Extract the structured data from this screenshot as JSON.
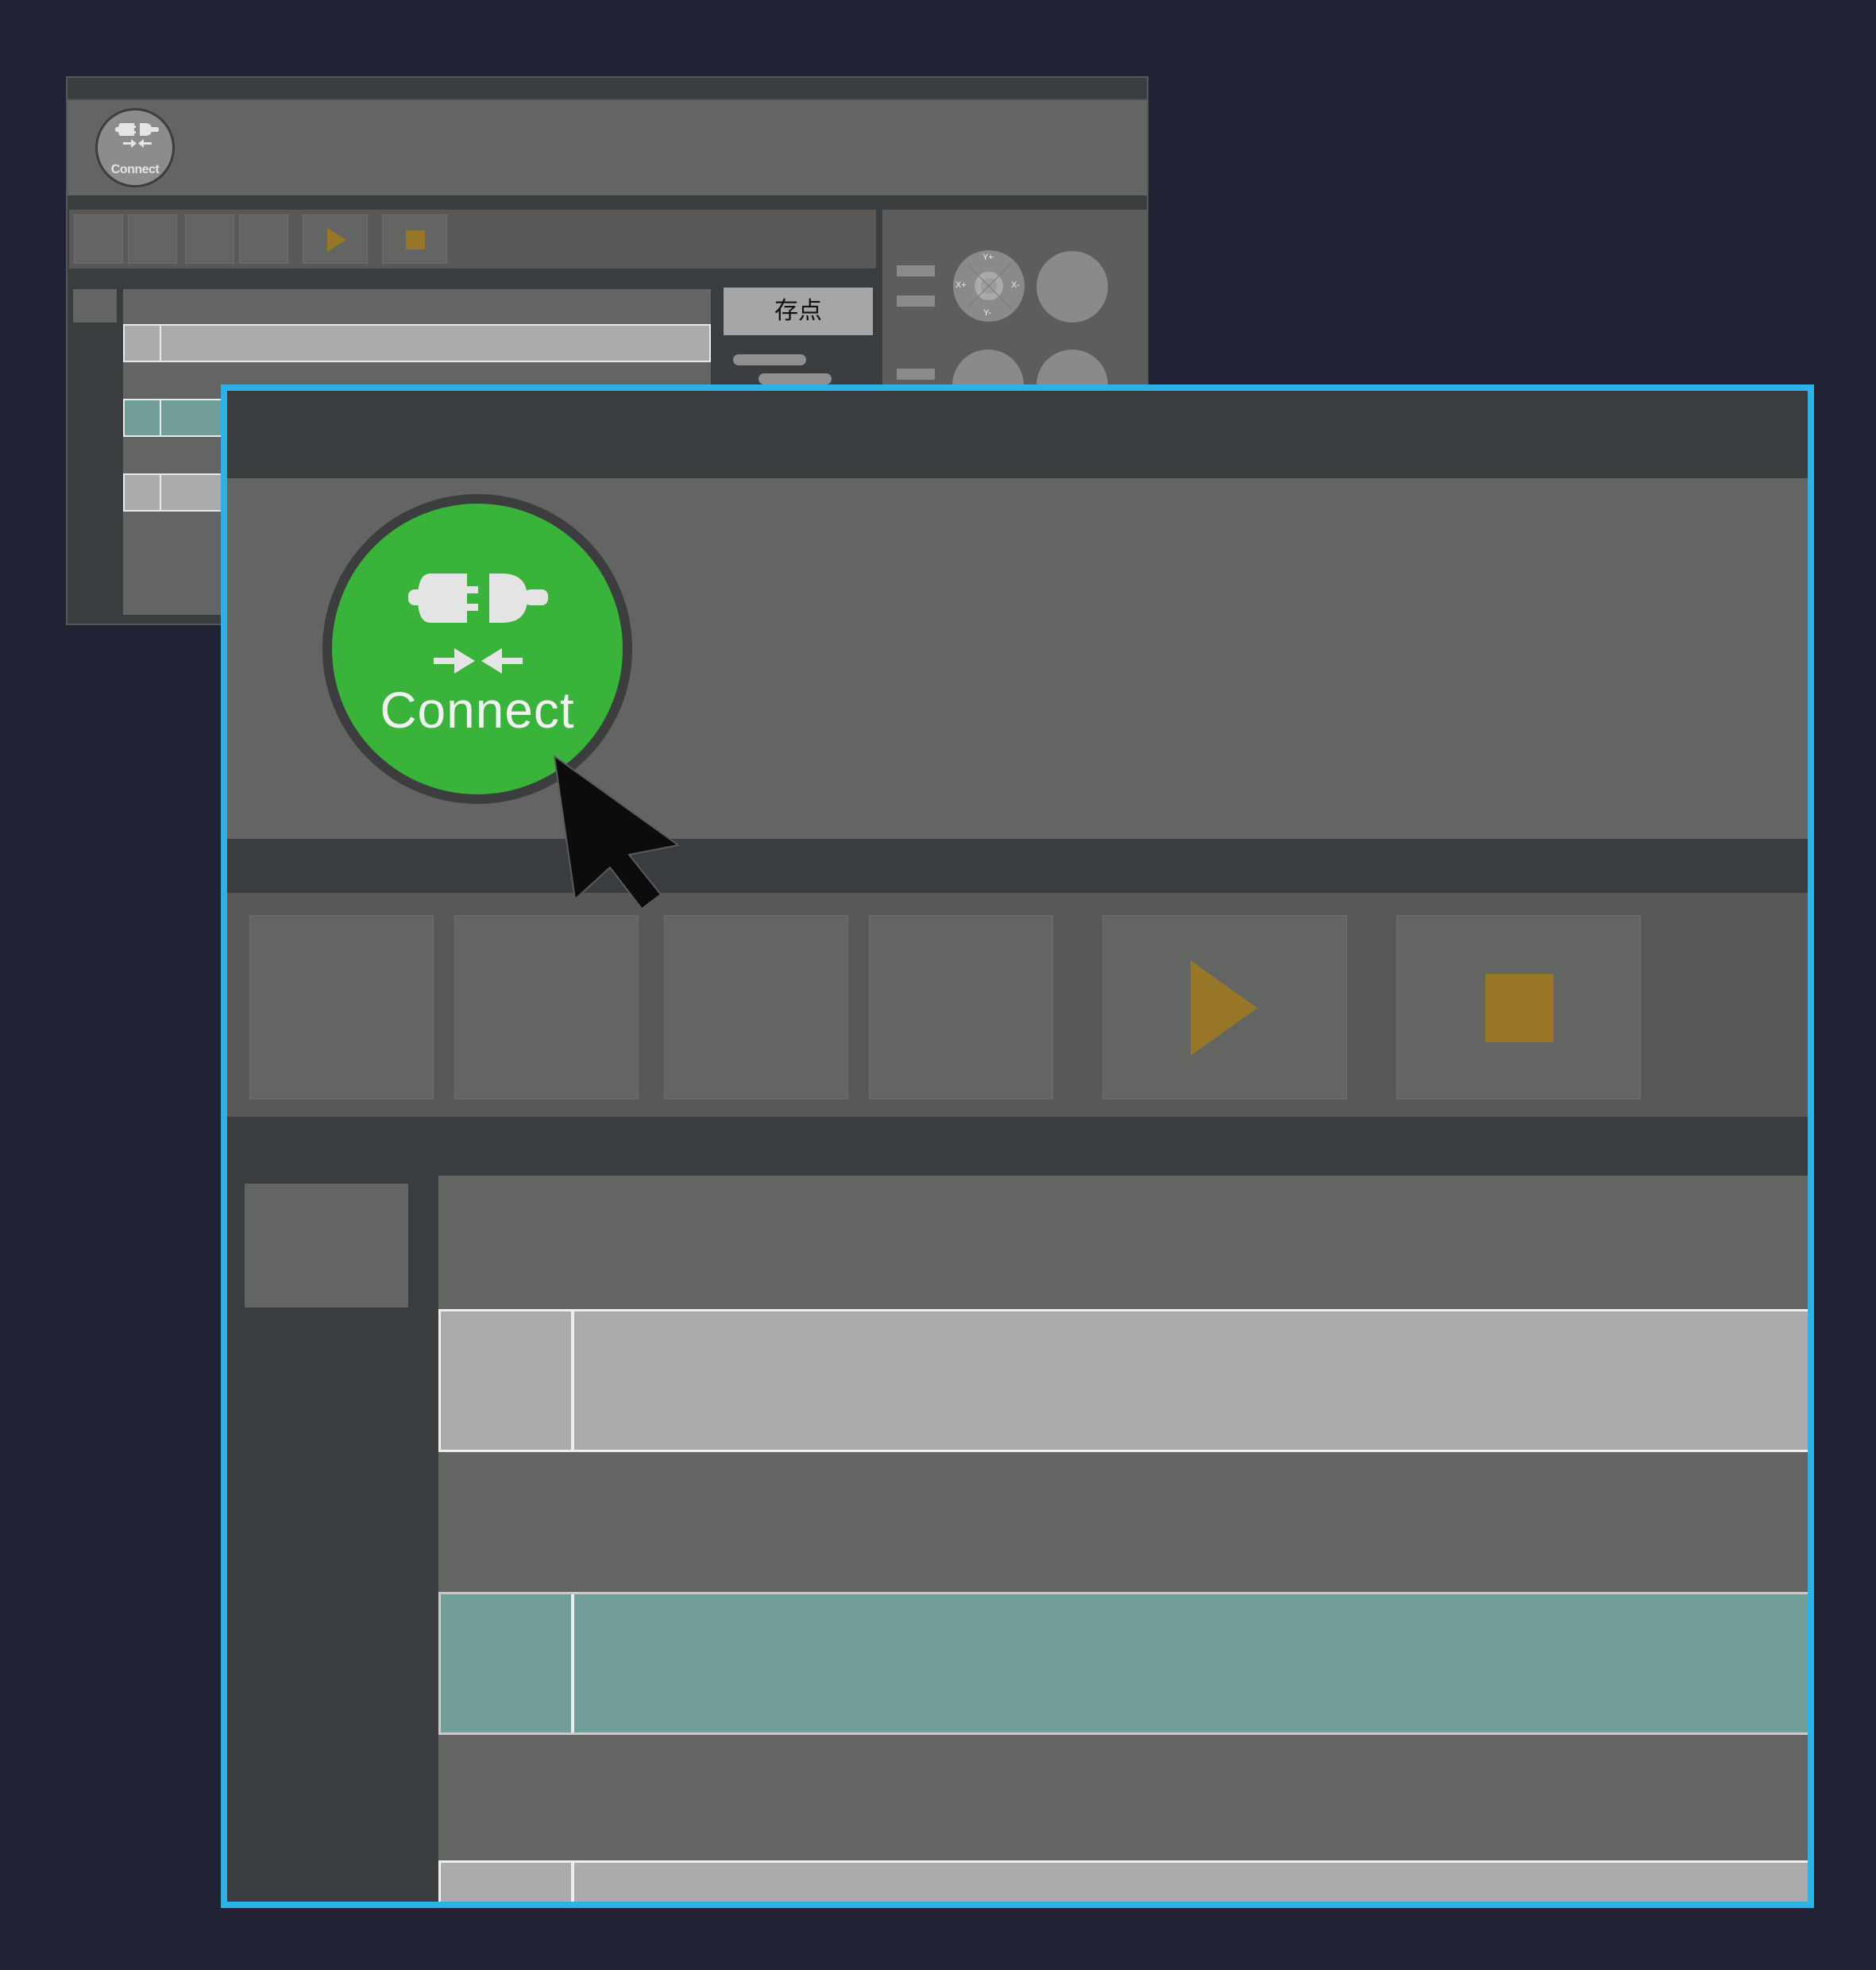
{
  "background_window": {
    "connect_label": "Connect",
    "save_point_label": "存点",
    "joystick_labels": {
      "up": "Y+",
      "down": "Y-",
      "left": "X+",
      "right": "X-"
    }
  },
  "foreground_window": {
    "connect_label": "Connect"
  },
  "colors": {
    "page_background": "#212335",
    "highlight_border": "#2db2e6",
    "connect_green": "#39b339",
    "play_stop_icon": "#987628",
    "selected_row": "#729e99",
    "row": "#ababab",
    "panel": "#636563",
    "dark_panel": "#3a3d40"
  },
  "icons": [
    "plug-icon",
    "arrows-in-icon",
    "play-icon",
    "stop-icon",
    "mouse-cursor-icon",
    "joystick-icon"
  ]
}
